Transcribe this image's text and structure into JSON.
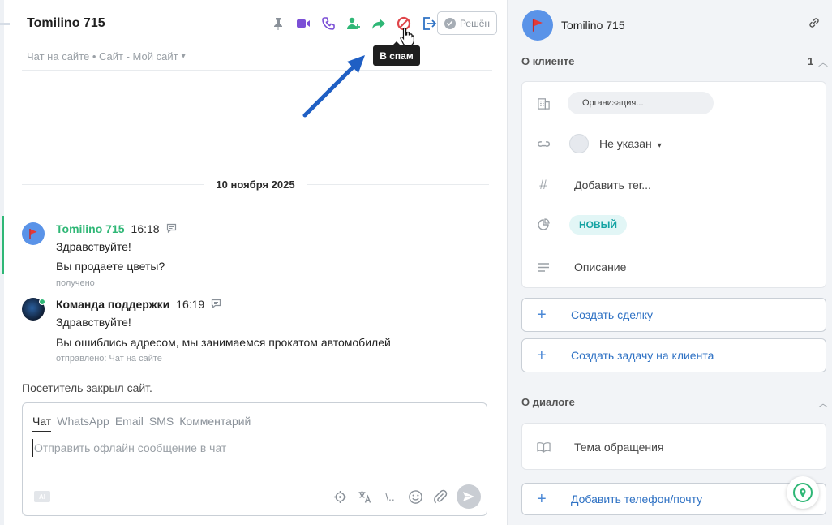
{
  "chat": {
    "title": "Tomilino 715",
    "channel": "Чат на сайте • Сайт - Мой сайт",
    "resolve_label": "Решён",
    "tooltip": "В спам",
    "date_separator": "10 ноября 2025",
    "messages": [
      {
        "author": "Tomilino 715",
        "time": "16:18",
        "lines": [
          "Здравствуйте!",
          "Вы продаете цветы?"
        ],
        "meta": "получено",
        "author_color": "#2fb776"
      },
      {
        "author": "Команда поддержки",
        "time": "16:19",
        "lines": [
          "Здравствуйте!",
          "Вы ошиблись адресом, мы занимаемся прокатом автомобилей"
        ],
        "meta": "отправлено: Чат на сайте",
        "author_color": "#1f1f1f"
      }
    ],
    "visitor_note": "Посетитель закрыл сайт.",
    "composer": {
      "tabs": [
        "Чат",
        "WhatsApp",
        "Email",
        "SMS",
        "Комментарий"
      ],
      "active_tab": "Чат",
      "placeholder": "Отправить офлайн сообщение в чат",
      "ai_badge": "AI",
      "quick_reply_glyph": "\\..",
      "tools": [
        "target-icon",
        "translate-icon",
        "quick-reply-icon",
        "emoji-icon",
        "attach-icon",
        "send-icon"
      ]
    },
    "toolbar_icons": [
      "pin-icon",
      "video-call-icon",
      "phone-icon",
      "add-user-icon",
      "forward-icon",
      "spam-icon",
      "exit-icon"
    ],
    "colors": {
      "pin": "#8a9199",
      "video": "#7b4fd6",
      "phone": "#7b4fd6",
      "add_user": "#2fb776",
      "forward": "#2fb776",
      "spam": "#e0464b",
      "exit": "#2f72c4"
    }
  },
  "side": {
    "client_name": "Tomilino 715",
    "about_client": {
      "title": "О клиенте",
      "count": "1",
      "organization_placeholder": "Организация...",
      "contact_value": "Не указан",
      "tag_placeholder": "Добавить тег...",
      "status": "НОВЫЙ",
      "description": "Описание"
    },
    "actions": {
      "create_deal": "Создать сделку",
      "create_task": "Создать задачу на клиента",
      "add_contact": "Добавить телефон/почту"
    },
    "about_dialog": {
      "title": "О диалоге",
      "topic": "Тема обращения"
    }
  }
}
